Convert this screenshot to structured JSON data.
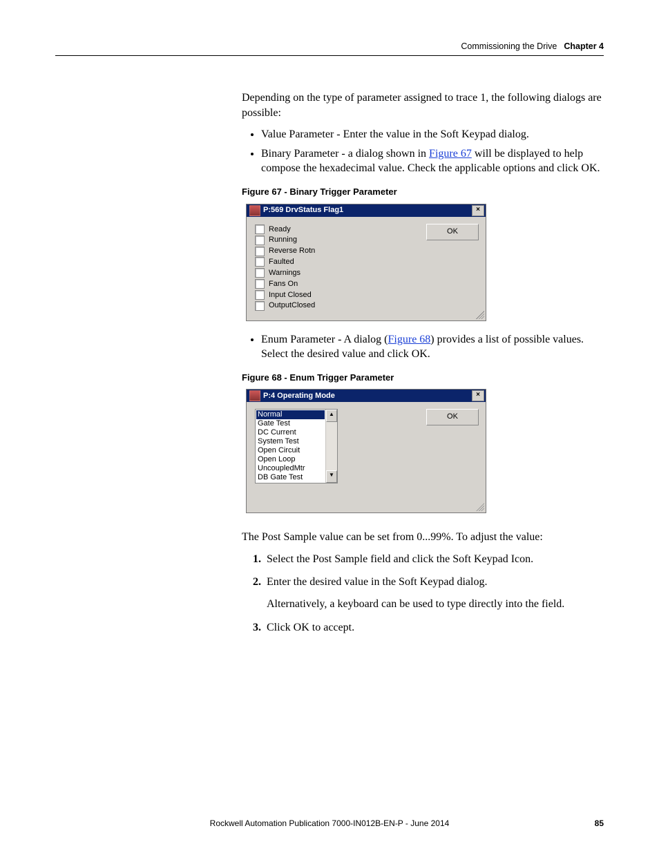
{
  "header": {
    "breadcrumb": "Commissioning the Drive",
    "chapter": "Chapter 4"
  },
  "intro": "Depending on the type of parameter assigned to trace 1, the following dialogs are possible:",
  "bullets1": {
    "b1": "Value Parameter - Enter the value in the Soft Keypad dialog.",
    "b2_pre": "Binary Parameter - a dialog shown in ",
    "b2_link": "Figure 67",
    "b2_post": " will be displayed to help compose the hexadecimal value. Check the applicable options and click OK."
  },
  "fig67_caption": "Figure 67 - Binary Trigger Parameter",
  "dlg67": {
    "title": "P:569 DrvStatus Flag1",
    "ok": "OK",
    "close": "×",
    "items": [
      "Ready",
      "Running",
      "Reverse Rotn",
      "Faulted",
      "Warnings",
      "Fans On",
      "Input Closed",
      "OutputClosed"
    ]
  },
  "bullets2": {
    "pre": "Enum Parameter - A dialog (",
    "link": "Figure 68",
    "post": ") provides a list of possible values. Select the desired value and click OK."
  },
  "fig68_caption": "Figure 68 - Enum Trigger Parameter",
  "dlg68": {
    "title": "P:4 Operating Mode",
    "ok": "OK",
    "close": "×",
    "items": [
      "Normal",
      "Gate Test",
      "DC Current",
      "System Test",
      "Open Circuit",
      "Open Loop",
      "UncoupledMtr",
      "DB Gate Test"
    ],
    "scroll_up": "▲",
    "scroll_down": "▼"
  },
  "post_intro": "The Post Sample value can be set from 0...99%. To adjust the value:",
  "steps": {
    "s1": "Select the Post Sample field and click the Soft Keypad Icon.",
    "s2": "Enter the desired value in the Soft Keypad dialog.",
    "s2b": "Alternatively, a keyboard can be used to type directly into the field.",
    "s3": "Click OK to accept."
  },
  "footer": {
    "pub": "Rockwell Automation Publication 7000-IN012B-EN-P - June 2014",
    "page": "85"
  }
}
